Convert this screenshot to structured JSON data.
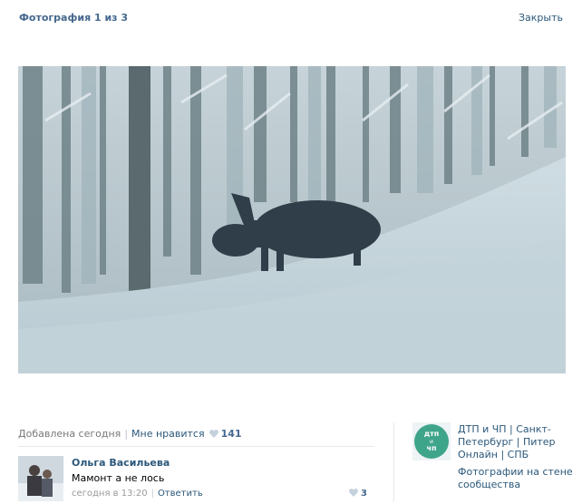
{
  "header": {
    "counter": "Фотография 1 из 3",
    "close_label": "Закрыть"
  },
  "photo": {
    "alt": "moose-in-snowy-forest"
  },
  "info": {
    "added": "Добавлена сегодня",
    "like_label": "Мне нравится",
    "like_count": "141"
  },
  "comment": {
    "author": "Ольга Васильева",
    "text": "Мамонт а не лось",
    "time": "сегодня в 13:20",
    "reply_label": "Ответить",
    "likes": "3"
  },
  "group": {
    "name": "ДТП и ЧП | Санкт-Петербург | Питер Онлайн | СПБ",
    "subtitle": "Фотографии на стене сообщества",
    "avatar_text_top": "дтп",
    "avatar_text_mid": "и",
    "avatar_text_bottom": "чп"
  },
  "colors": {
    "link": "#2b587a",
    "title": "#45688e",
    "heart": "#c4d1dd",
    "group_green": "#3fa58a"
  }
}
